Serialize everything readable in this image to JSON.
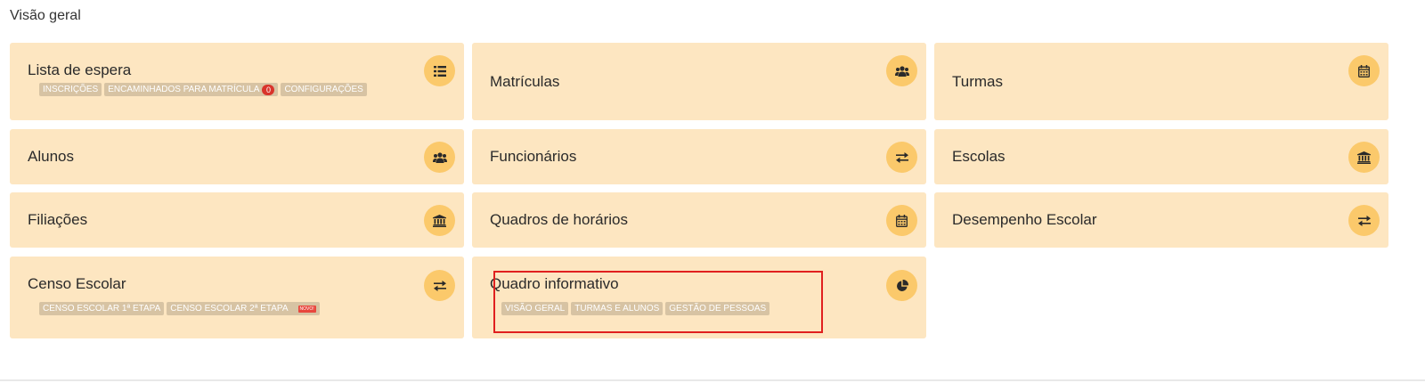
{
  "page_title": "Visão geral",
  "cards": {
    "lista_espera": {
      "title": "Lista de espera",
      "icon": "list-icon",
      "tags": [
        "INSCRIÇÕES",
        "ENCAMINHADOS PARA MATRÍCULA",
        "CONFIGURAÇÕES"
      ],
      "badge_count": "0"
    },
    "matriculas": {
      "title": "Matrículas",
      "icon": "users-icon"
    },
    "turmas": {
      "title": "Turmas",
      "icon": "calendar-icon"
    },
    "alunos": {
      "title": "Alunos",
      "icon": "users-icon"
    },
    "funcionarios": {
      "title": "Funcionários",
      "icon": "exchange-icon"
    },
    "escolas": {
      "title": "Escolas",
      "icon": "institution-icon"
    },
    "filiacoes": {
      "title": "Filiações",
      "icon": "institution-icon"
    },
    "quadros_horarios": {
      "title": "Quadros de horários",
      "icon": "calendar-icon"
    },
    "desempenho": {
      "title": "Desempenho Escolar",
      "icon": "exchange-icon"
    },
    "censo": {
      "title": "Censo Escolar",
      "icon": "exchange-icon",
      "tags": [
        "CENSO ESCOLAR 1ª ETAPA",
        "CENSO ESCOLAR 2ª ETAPA"
      ],
      "new_badge": "NOVO!"
    },
    "quadro_informativo": {
      "title": "Quadro informativo",
      "icon": "pie-chart-icon",
      "tags": [
        "VISÃO GERAL",
        "TURMAS E ALUNOS",
        "GESTÃO DE PESSOAS"
      ]
    }
  },
  "colors": {
    "card_bg": "#fde6c1",
    "icon_bg": "#fbc96b",
    "tag_bg": "#d7c3a3",
    "badge_red": "#d9342b",
    "highlight": "#e0201f"
  }
}
